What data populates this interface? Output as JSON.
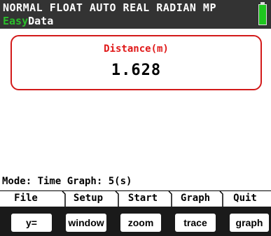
{
  "status": {
    "mode_text": "NORMAL FLOAT AUTO REAL RADIAN MP",
    "app_badge": "Easy",
    "app_name": "Data"
  },
  "meter": {
    "label": "Distance(m)",
    "value": "1.628"
  },
  "mode_line": "Mode: Time Graph: 5(s)",
  "menu": {
    "file": "File",
    "setup": "Setup",
    "start": "Start",
    "graph": "Graph",
    "quit": "Quit"
  },
  "keys": {
    "y": "y=",
    "window": "window",
    "zoom": "zoom",
    "trace": "trace",
    "graph": "graph"
  },
  "colors": {
    "accent_red": "#e01919",
    "status_bg": "#333333",
    "badge_green": "#2bbd2b",
    "battery_green": "#1ec51e",
    "key_strip": "#1a1a1a"
  }
}
